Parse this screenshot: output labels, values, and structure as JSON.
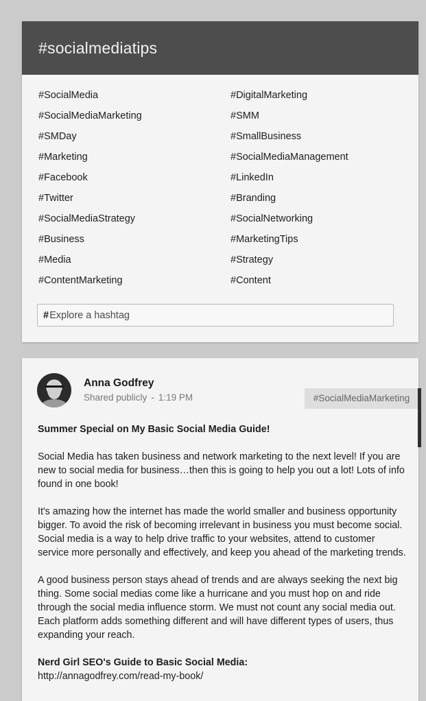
{
  "tags_card": {
    "title": "#socialmediatips",
    "left_column": [
      "#SocialMedia",
      "#SocialMediaMarketing",
      "#SMDay",
      "#Marketing",
      "#Facebook",
      "#Twitter",
      "#SocialMediaStrategy",
      "#Business",
      "#Media",
      "#ContentMarketing"
    ],
    "right_column": [
      "#DigitalMarketing",
      "#SMM",
      "#SmallBusiness",
      "#SocialMediaManagement",
      "#LinkedIn",
      "#Branding",
      "#SocialNetworking",
      "#MarketingTips",
      "#Strategy",
      "#Content"
    ],
    "explore": {
      "hash": "#",
      "placeholder": "Explore a hashtag"
    }
  },
  "post": {
    "author": "Anna Godfrey",
    "visibility": "Shared publicly",
    "separator": "-",
    "time": "1:19 PM",
    "hashtag": "#SocialMediaMarketing",
    "title": "Summer Special on My Basic Social Media Guide!",
    "paragraphs": [
      "Social Media has taken business and network marketing to the next level!  If you are new to social media for business…then this is going to help you out a lot!  Lots of info found in one book!",
      "It's amazing how the internet has made the world smaller and business opportunity bigger. To avoid the risk of becoming irrelevant in business you must become social. Social media is a way to help drive traffic to your websites, attend to customer service more personally and effectively, and keep you ahead of the marketing trends.",
      "A good business person stays ahead of trends and are always seeking the next big thing. Some social medias come like a hurricane and you must hop on and ride through the social media influence storm. We must not count any social media out. Each platform adds something different and will have different types of users, thus expanding your reach."
    ],
    "guide_title": "Nerd Girl SEO's Guide to Basic Social Media:",
    "link": "http://annagodfrey.com/read-my-book/"
  }
}
